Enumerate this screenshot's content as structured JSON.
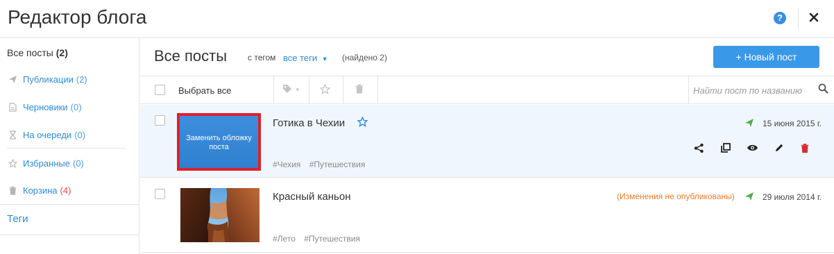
{
  "header": {
    "title": "Редактор блога",
    "help_label": "?",
    "close_label": "✕"
  },
  "sidebar": {
    "all_label": "Все посты",
    "all_count": "(2)",
    "items": [
      {
        "label": "Публикации",
        "count": "(2)",
        "icon": "send-icon"
      },
      {
        "label": "Черновики",
        "count": "(0)",
        "icon": "document-icon"
      },
      {
        "label": "На очереди",
        "count": "(0)",
        "icon": "hourglass-icon"
      },
      {
        "label": "Избранные",
        "count": "(0)",
        "icon": "star-icon"
      },
      {
        "label": "Корзина",
        "count": "(4)",
        "icon": "trash-icon"
      }
    ],
    "tags_label": "Теги"
  },
  "main": {
    "title": "Все посты",
    "filter_prefix": "с тегом",
    "filter_value": "все теги",
    "found": "(найдено 2)",
    "new_post_label": "+ Новый пост"
  },
  "toolbar": {
    "select_all": "Выбрать все",
    "search_placeholder": "Найти пост по названию"
  },
  "posts": [
    {
      "title": "Готика в Чехии",
      "cover_label": "Заменить обложку поста",
      "tags": [
        "#Чехия",
        "#Путешествия"
      ],
      "date": "15 июня 2015 г.",
      "status_note": ""
    },
    {
      "title": "Красный каньон",
      "cover_label": "",
      "tags": [
        "#Лето",
        "#Путешествия"
      ],
      "date": "29 июля 2014 г.",
      "status_note": "(Изменения не опубликованы)"
    }
  ],
  "colors": {
    "accent": "#3a98e8",
    "link": "#2f8ad8",
    "published": "#4caf50",
    "danger": "#d32f2f",
    "warning": "#f07a2a"
  }
}
